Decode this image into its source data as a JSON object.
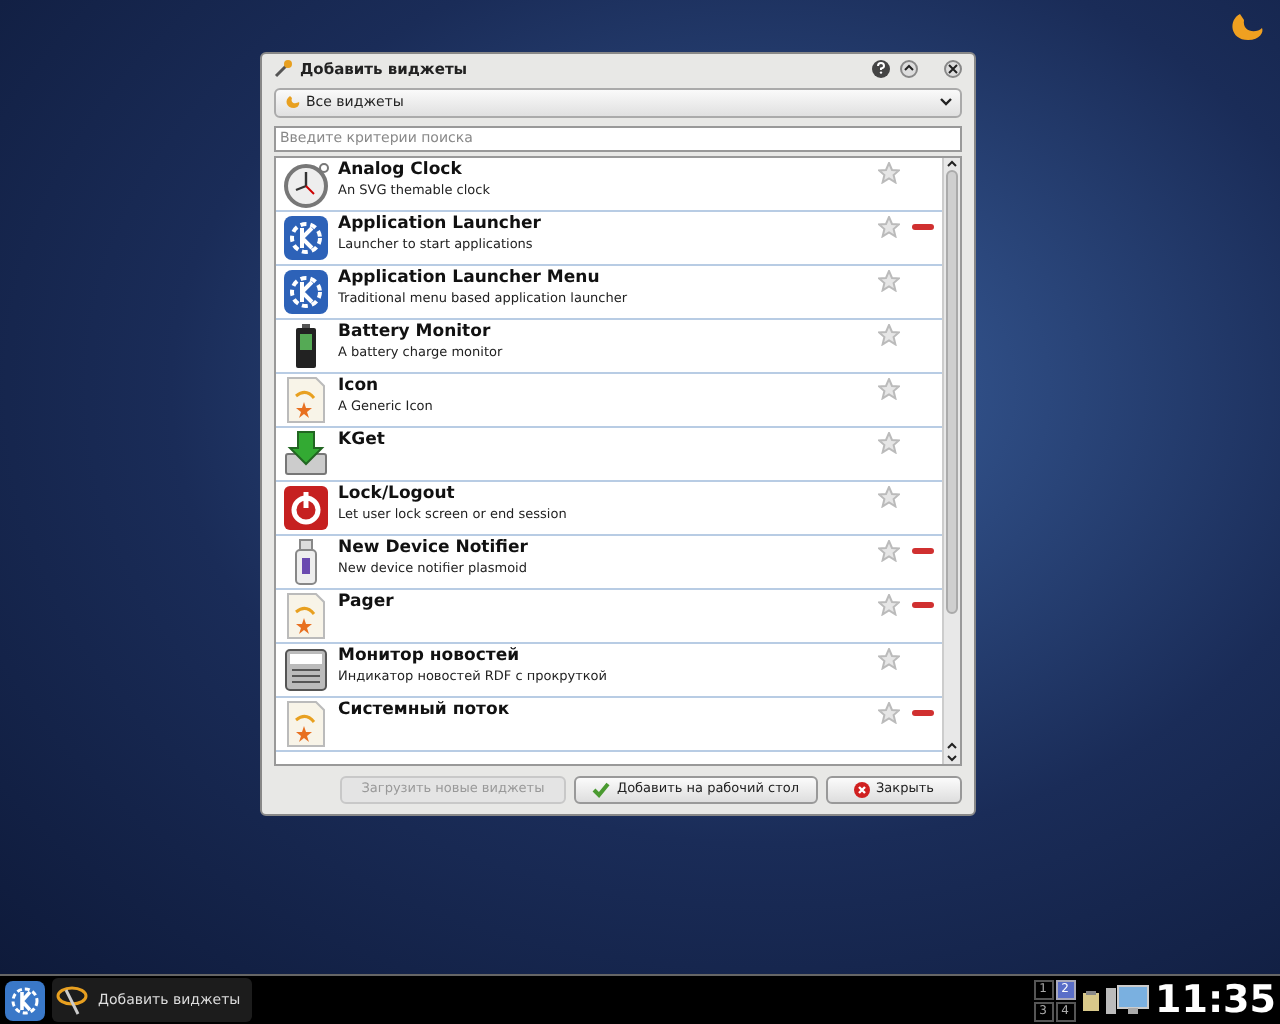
{
  "window": {
    "title": "Добавить виджеты"
  },
  "category": {
    "value": "Все виджеты"
  },
  "search": {
    "placeholder": "Введите критерии поиска"
  },
  "widgets": [
    {
      "name": "Analog Clock",
      "description": "An SVG themable clock",
      "kind": "clock",
      "running": false
    },
    {
      "name": "Application Launcher",
      "description": "Launcher to start applications",
      "kind": "kde",
      "running": true
    },
    {
      "name": "Application Launcher Menu",
      "description": "Traditional menu based application launcher",
      "kind": "kde",
      "running": false
    },
    {
      "name": "Battery Monitor",
      "description": "A battery charge monitor",
      "kind": "battery",
      "running": false
    },
    {
      "name": "Icon",
      "description": "A Generic Icon",
      "kind": "generic",
      "running": false
    },
    {
      "name": "KGet",
      "kind": "download",
      "running": false
    },
    {
      "name": "Lock/Logout",
      "description": "Let user lock screen or end session",
      "kind": "power",
      "running": false
    },
    {
      "name": "New Device Notifier",
      "description": "New device notifier plasmoid",
      "kind": "usb",
      "running": true
    },
    {
      "name": "Pager",
      "kind": "generic",
      "running": true
    },
    {
      "name": "Монитор новостей",
      "description": "Индикатор новостей RDF с прокруткой",
      "kind": "news",
      "running": false
    },
    {
      "name": "Системный поток",
      "kind": "generic",
      "running": true
    }
  ],
  "buttons": [
    {
      "label": "Загрузить новые виджеты",
      "disabled": true,
      "kind": "plain"
    },
    {
      "label": "Добавить на рабочий стол",
      "disabled": false,
      "kind": "check"
    },
    {
      "label": "Закрыть",
      "disabled": false,
      "kind": "close"
    }
  ],
  "taskbar": {
    "task": "Добавить виджеты",
    "pager": [
      {
        "label": "1",
        "selected": false
      },
      {
        "label": "2",
        "selected": true
      },
      {
        "label": "3",
        "selected": false
      },
      {
        "label": "4",
        "selected": false
      }
    ],
    "clock": "11:35"
  }
}
